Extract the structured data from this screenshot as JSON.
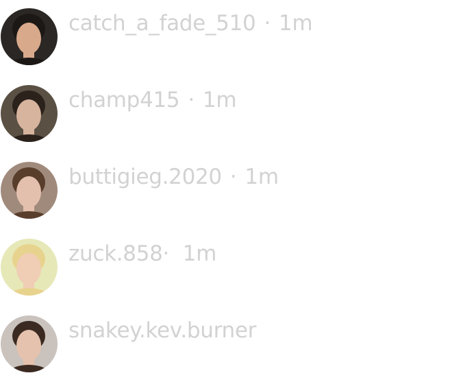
{
  "items": [
    {
      "username": "catch_a_fade_510",
      "separator": "·",
      "time": "1m",
      "avatar": {
        "bg": "#2b2724",
        "skin": "#d9a98c",
        "hair": "#1c1816"
      }
    },
    {
      "username": "champ415",
      "separator": "·",
      "time": "1m",
      "avatar": {
        "bg": "#5a5044",
        "skin": "#d7b49e",
        "hair": "#2b221c"
      }
    },
    {
      "username": "buttigieg.2020",
      "separator": "·",
      "time": "1m",
      "avatar": {
        "bg": "#a08a7c",
        "skin": "#e3c0ad",
        "hair": "#5a3e2c"
      }
    },
    {
      "username": "zuck.858",
      "separator": "·",
      "time": "1m",
      "avatar": {
        "bg": "#e6e8b8",
        "skin": "#f0cdb5",
        "hair": "#e8d38e"
      }
    },
    {
      "username": "snakey.kev.burner",
      "avatar": {
        "bg": "#c9c2bd",
        "skin": "#e5c2ad",
        "hair": "#3b2a22"
      }
    }
  ]
}
